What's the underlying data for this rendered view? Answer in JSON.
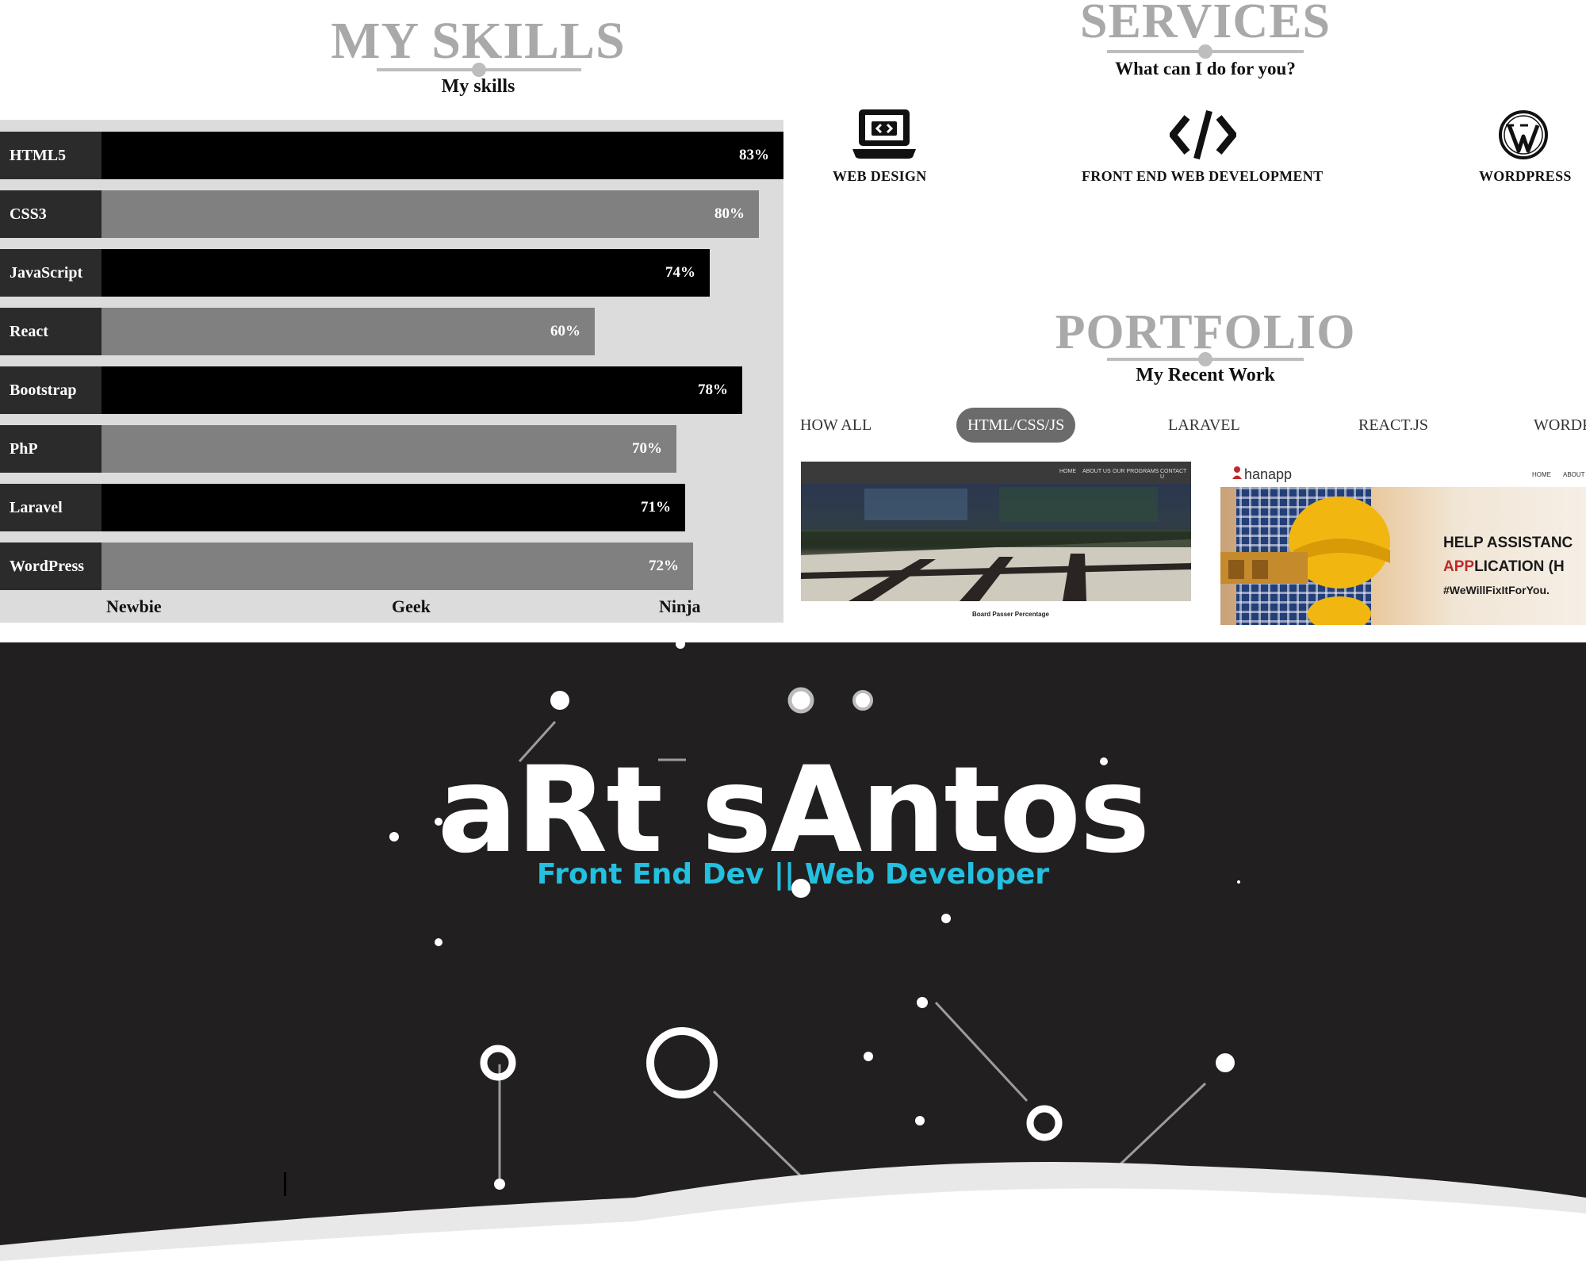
{
  "skills": {
    "title": "MY SKILLS",
    "subtitle": "My skills",
    "items": [
      {
        "name": "HTML5",
        "percent": 83,
        "label": "83%"
      },
      {
        "name": "CSS3",
        "percent": 80,
        "label": "80%"
      },
      {
        "name": "JavaScript",
        "percent": 74,
        "label": "74%"
      },
      {
        "name": "React",
        "percent": 60,
        "label": "60%"
      },
      {
        "name": "Bootstrap",
        "percent": 78,
        "label": "78%"
      },
      {
        "name": "PhP",
        "percent": 70,
        "label": "70%"
      },
      {
        "name": "Laravel",
        "percent": 71,
        "label": "71%"
      },
      {
        "name": "WordPress",
        "percent": 72,
        "label": "72%"
      }
    ],
    "scale": [
      "Newbie",
      "Geek",
      "Ninja"
    ],
    "colors": {
      "dark_bar": "#000000",
      "light_bar": "#808080",
      "label_bg": "#2b2b2b",
      "panel_bg": "#dcdcdd"
    }
  },
  "services": {
    "title": "SERVICES",
    "subtitle": "What can I do for you?",
    "items": [
      {
        "icon": "laptop-code-icon",
        "name": "WEB DESIGN"
      },
      {
        "icon": "code-icon",
        "name": "FRONT END WEB DEVELOPMENT"
      },
      {
        "icon": "wordpress-icon",
        "name": "WORDPRESS"
      }
    ]
  },
  "portfolio": {
    "title": "PORTFOLIO",
    "subtitle": "My Recent Work",
    "filters": [
      "HOW ALL",
      "HTML/CSS/JS",
      "LARAVEL",
      "REACT.JS",
      "WORDP"
    ],
    "active_filter": "HTML/CSS/JS",
    "thumb1": {
      "nav": [
        "HOME",
        "ABOUT US",
        "OUR PROGRAMS",
        "CONTACT U"
      ],
      "caption": "Board Passer Percentage"
    },
    "thumb2": {
      "logo": "hanapp",
      "nav": [
        "HOME",
        "ABOUT"
      ],
      "headline1": "HELP ASSISTANC",
      "headline2_accent": "APP",
      "headline2_rest": "LICATION (H",
      "hashtag": "#WeWillFixItForYou."
    }
  },
  "hero": {
    "name": "aRt sAntos",
    "tagline": "Front End Dev || Web Developer",
    "accent_color": "#23c0e0",
    "bg_color": "#221f20"
  }
}
